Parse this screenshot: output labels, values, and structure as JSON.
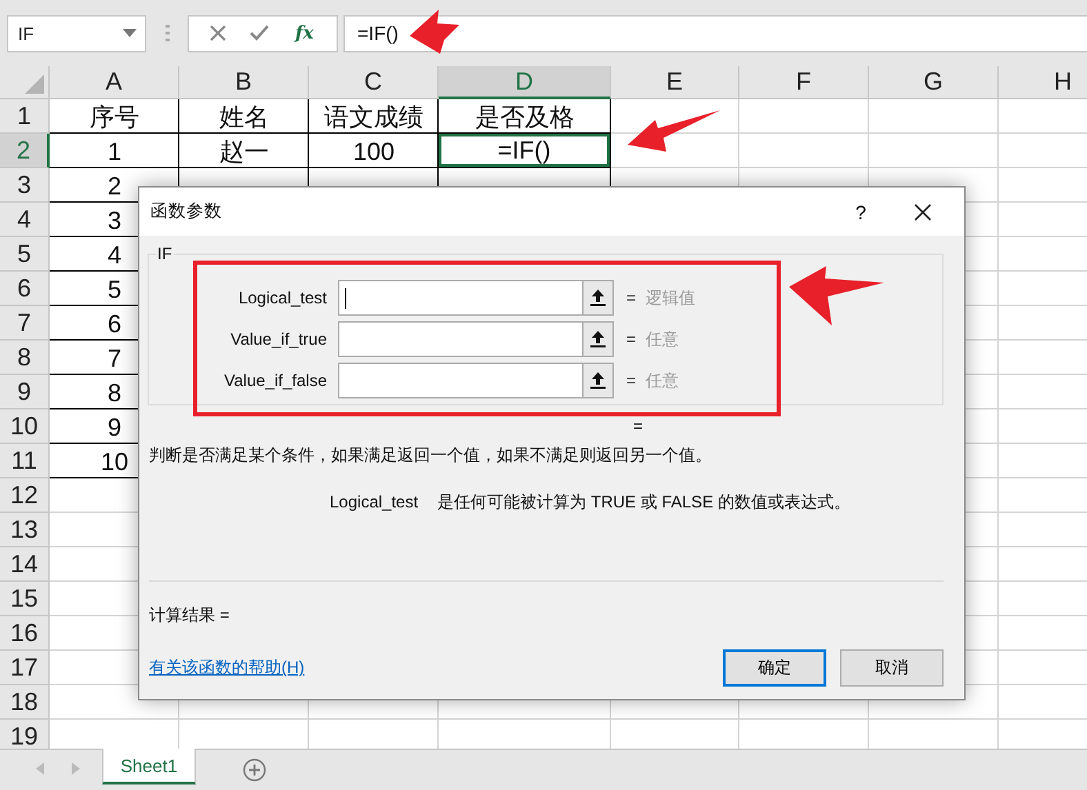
{
  "name_box": {
    "value": "IF"
  },
  "formula_bar": {
    "insert_function": "fx",
    "formula": "=IF()"
  },
  "columns": [
    {
      "label": "A",
      "selected": false
    },
    {
      "label": "B",
      "selected": false
    },
    {
      "label": "C",
      "selected": false
    },
    {
      "label": "D",
      "selected": true
    },
    {
      "label": "E",
      "selected": false
    },
    {
      "label": "F",
      "selected": false
    },
    {
      "label": "G",
      "selected": false
    },
    {
      "label": "H",
      "selected": false
    }
  ],
  "rows": [
    {
      "header": "1",
      "selected": false,
      "cells": [
        {
          "text": "序号",
          "selected": false
        },
        {
          "text": "姓名",
          "selected": false
        },
        {
          "text": "语文成绩",
          "selected": false
        },
        {
          "text": "是否及格",
          "selected": false
        }
      ]
    },
    {
      "header": "2",
      "selected": true,
      "cells": [
        {
          "text": "1",
          "selected": false
        },
        {
          "text": "赵一",
          "selected": false
        },
        {
          "text": "100",
          "selected": false
        },
        {
          "text": "=IF()",
          "selected": true
        }
      ]
    },
    {
      "header": "3",
      "selected": false,
      "cells": [
        {
          "text": "2",
          "selected": false
        }
      ]
    },
    {
      "header": "4",
      "selected": false,
      "cells": [
        {
          "text": "3",
          "selected": false
        }
      ]
    },
    {
      "header": "5",
      "selected": false,
      "cells": [
        {
          "text": "4",
          "selected": false
        }
      ]
    },
    {
      "header": "6",
      "selected": false,
      "cells": [
        {
          "text": "5",
          "selected": false
        }
      ]
    },
    {
      "header": "7",
      "selected": false,
      "cells": [
        {
          "text": "6",
          "selected": false
        }
      ]
    },
    {
      "header": "8",
      "selected": false,
      "cells": [
        {
          "text": "7",
          "selected": false
        }
      ]
    },
    {
      "header": "9",
      "selected": false,
      "cells": [
        {
          "text": "8",
          "selected": false
        }
      ]
    },
    {
      "header": "10",
      "selected": false,
      "cells": [
        {
          "text": "9",
          "selected": false
        }
      ]
    },
    {
      "header": "11",
      "selected": false,
      "cells": [
        {
          "text": "10",
          "selected": false
        }
      ]
    },
    {
      "header": "12",
      "selected": false
    },
    {
      "header": "13",
      "selected": false
    },
    {
      "header": "14",
      "selected": false
    },
    {
      "header": "15",
      "selected": false
    },
    {
      "header": "16",
      "selected": false
    },
    {
      "header": "17",
      "selected": false
    },
    {
      "header": "18",
      "selected": false
    },
    {
      "header": "19",
      "selected": false
    }
  ],
  "sheet_tabs": [
    {
      "label": "Sheet1",
      "selected": true
    }
  ],
  "dialog": {
    "title": "函数参数",
    "help": "?",
    "function_name": "IF",
    "arguments": [
      {
        "label": "Logical_test",
        "focused": true,
        "sign": "=",
        "hint": "逻辑值"
      },
      {
        "label": "Value_if_true",
        "focused": false,
        "sign": "=",
        "hint": "任意"
      },
      {
        "label": "Value_if_false",
        "focused": false,
        "sign": "=",
        "hint": "任意"
      }
    ],
    "result_sign": "=",
    "description": "判断是否满足某个条件，如果满足返回一个值，如果不满足则返回另一个值。",
    "argument_help": {
      "name": "Logical_test",
      "text": "是任何可能被计算为 TRUE 或 FALSE 的数值或表达式。"
    },
    "result_label": "计算结果 =",
    "help_link": "有关该函数的帮助(H)",
    "buttons": [
      {
        "label": "确定",
        "default": true
      },
      {
        "label": "取消",
        "default": false
      }
    ]
  }
}
